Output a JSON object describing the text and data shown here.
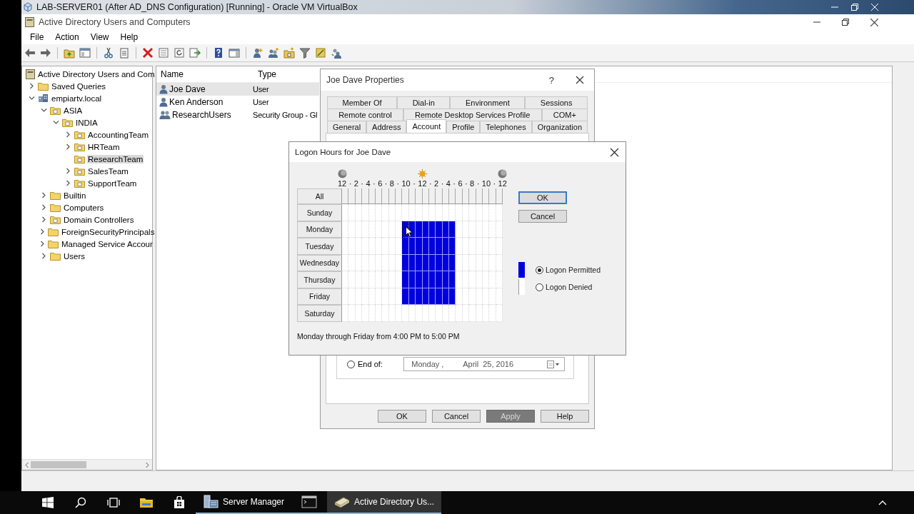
{
  "vm_window": {
    "title": "LAB-SERVER01 (After AD_DNS Configuration) [Running] - Oracle VM VirtualBox"
  },
  "app_window": {
    "title": "Active Directory Users and Computers"
  },
  "menu": [
    "File",
    "Action",
    "View",
    "Help"
  ],
  "tree": {
    "label": "Active Directory Users and Com",
    "kind": "root",
    "children": [
      {
        "label": "Saved Queries",
        "kind": "folder",
        "expandable": true,
        "expanded": false,
        "selected": false
      },
      {
        "label": "empiartv.local",
        "kind": "domain",
        "expandable": true,
        "expanded": true,
        "selected": false,
        "children": [
          {
            "label": "ASIA",
            "kind": "ou",
            "expandable": true,
            "expanded": true,
            "selected": false,
            "children": [
              {
                "label": "INDIA",
                "kind": "ou",
                "expandable": true,
                "expanded": true,
                "selected": false,
                "children": [
                  {
                    "label": "AccountingTeam",
                    "kind": "ou",
                    "expandable": true,
                    "expanded": false,
                    "selected": false
                  },
                  {
                    "label": "HRTeam",
                    "kind": "ou",
                    "expandable": true,
                    "expanded": false,
                    "selected": false
                  },
                  {
                    "label": "ResearchTeam",
                    "kind": "ou",
                    "expandable": false,
                    "selected": true
                  },
                  {
                    "label": "SalesTeam",
                    "kind": "ou",
                    "expandable": true,
                    "expanded": false,
                    "selected": false
                  },
                  {
                    "label": "SupportTeam",
                    "kind": "ou",
                    "expandable": true,
                    "expanded": false,
                    "selected": false
                  }
                ]
              }
            ]
          },
          {
            "label": "Builtin",
            "kind": "folder",
            "expandable": true,
            "expanded": false,
            "selected": false
          },
          {
            "label": "Computers",
            "kind": "folder",
            "expandable": true,
            "expanded": false,
            "selected": false
          },
          {
            "label": "Domain Controllers",
            "kind": "ou",
            "expandable": true,
            "expanded": false,
            "selected": false
          },
          {
            "label": "ForeignSecurityPrincipals",
            "kind": "folder",
            "expandable": true,
            "expanded": false,
            "selected": false
          },
          {
            "label": "Managed Service Accour",
            "kind": "folder",
            "expandable": true,
            "expanded": false,
            "selected": false
          },
          {
            "label": "Users",
            "kind": "folder",
            "expandable": true,
            "expanded": false,
            "selected": false
          }
        ]
      }
    ]
  },
  "list": {
    "columns": [
      "Name",
      "Type"
    ],
    "rows": [
      {
        "name": "Joe Dave",
        "type": "User",
        "kind": "user",
        "selected": true
      },
      {
        "name": "Ken Anderson",
        "type": "User",
        "kind": "user",
        "selected": false
      },
      {
        "name": "ResearchUsers",
        "type": "Security Group - Gl",
        "kind": "group",
        "selected": false
      }
    ]
  },
  "properties_dialog": {
    "title": "Joe Dave Properties",
    "help_label": "?",
    "tab_rows": [
      [
        {
          "label": "Member Of",
          "selected": false
        },
        {
          "label": "Dial-in",
          "selected": false
        },
        {
          "label": "Environment",
          "selected": false
        },
        {
          "label": "Sessions",
          "selected": false
        }
      ],
      [
        {
          "label": "Remote control",
          "selected": false
        },
        {
          "label": "Remote Desktop Services Profile",
          "selected": false
        },
        {
          "label": "COM+",
          "selected": false
        }
      ],
      [
        {
          "label": "General",
          "selected": false
        },
        {
          "label": "Address",
          "selected": false
        },
        {
          "label": "Account",
          "selected": true
        },
        {
          "label": "Profile",
          "selected": false
        },
        {
          "label": "Telephones",
          "selected": false
        },
        {
          "label": "Organization",
          "selected": false
        }
      ]
    ],
    "end_of": {
      "label": "End of:",
      "selected": false,
      "date_parts": [
        "Monday",
        ",",
        "April",
        "25, 2016"
      ]
    },
    "buttons": [
      {
        "label": "OK",
        "disabled": false
      },
      {
        "label": "Cancel",
        "disabled": false
      },
      {
        "label": "Apply",
        "disabled": true
      },
      {
        "label": "Help",
        "disabled": false
      }
    ]
  },
  "logon_dialog": {
    "title": "Logon Hours for Joe Dave",
    "ticks": [
      "12",
      "2",
      "4",
      "6",
      "8",
      "10",
      "12",
      "2",
      "4",
      "6",
      "8",
      "10",
      "12"
    ],
    "separator": "·",
    "all_label": "All",
    "days": [
      {
        "label": "Sunday",
        "focused": false,
        "permitted": [
          false,
          false,
          false,
          false,
          false,
          false,
          false,
          false,
          false,
          false,
          false,
          false,
          false,
          false,
          false,
          false,
          false,
          false,
          false,
          false,
          false,
          false,
          false,
          false
        ]
      },
      {
        "label": "Monday",
        "focused": true,
        "permitted": [
          false,
          false,
          false,
          false,
          false,
          false,
          false,
          false,
          false,
          true,
          true,
          true,
          true,
          true,
          true,
          true,
          true,
          false,
          false,
          false,
          false,
          false,
          false,
          false
        ]
      },
      {
        "label": "Tuesday",
        "focused": false,
        "permitted": [
          false,
          false,
          false,
          false,
          false,
          false,
          false,
          false,
          false,
          true,
          true,
          true,
          true,
          true,
          true,
          true,
          true,
          false,
          false,
          false,
          false,
          false,
          false,
          false
        ]
      },
      {
        "label": "Wednesday",
        "focused": false,
        "permitted": [
          false,
          false,
          false,
          false,
          false,
          false,
          false,
          false,
          false,
          true,
          true,
          true,
          true,
          true,
          true,
          true,
          true,
          false,
          false,
          false,
          false,
          false,
          false,
          false
        ]
      },
      {
        "label": "Thursday",
        "focused": false,
        "permitted": [
          false,
          false,
          false,
          false,
          false,
          false,
          false,
          false,
          false,
          true,
          true,
          true,
          true,
          true,
          true,
          true,
          true,
          false,
          false,
          false,
          false,
          false,
          false,
          false
        ]
      },
      {
        "label": "Friday",
        "focused": false,
        "permitted": [
          false,
          false,
          false,
          false,
          false,
          false,
          false,
          false,
          false,
          true,
          true,
          true,
          true,
          true,
          true,
          true,
          true,
          false,
          false,
          false,
          false,
          false,
          false,
          false
        ]
      },
      {
        "label": "Saturday",
        "focused": false,
        "permitted": [
          false,
          false,
          false,
          false,
          false,
          false,
          false,
          false,
          false,
          false,
          false,
          false,
          false,
          false,
          false,
          false,
          false,
          false,
          false,
          false,
          false,
          false,
          false,
          false
        ]
      }
    ],
    "legend": [
      {
        "label": "Logon Permitted",
        "kind": "permitted",
        "selected": true
      },
      {
        "label": "Logon Denied",
        "kind": "denied",
        "selected": false
      }
    ],
    "buttons": [
      {
        "label": "OK",
        "default": true
      },
      {
        "label": "Cancel",
        "default": false
      }
    ],
    "summary": "Monday through Friday from 4:00 PM to 5:00 PM"
  },
  "taskbar": {
    "items": [
      {
        "kind": "start"
      },
      {
        "kind": "search"
      },
      {
        "kind": "taskview"
      },
      {
        "kind": "explorer"
      },
      {
        "kind": "store"
      },
      {
        "kind": "server",
        "label": "Server Manager",
        "active": false
      },
      {
        "kind": "terminal",
        "active": false
      },
      {
        "kind": "directory",
        "label": "Active Directory Us...",
        "active": true
      }
    ]
  }
}
